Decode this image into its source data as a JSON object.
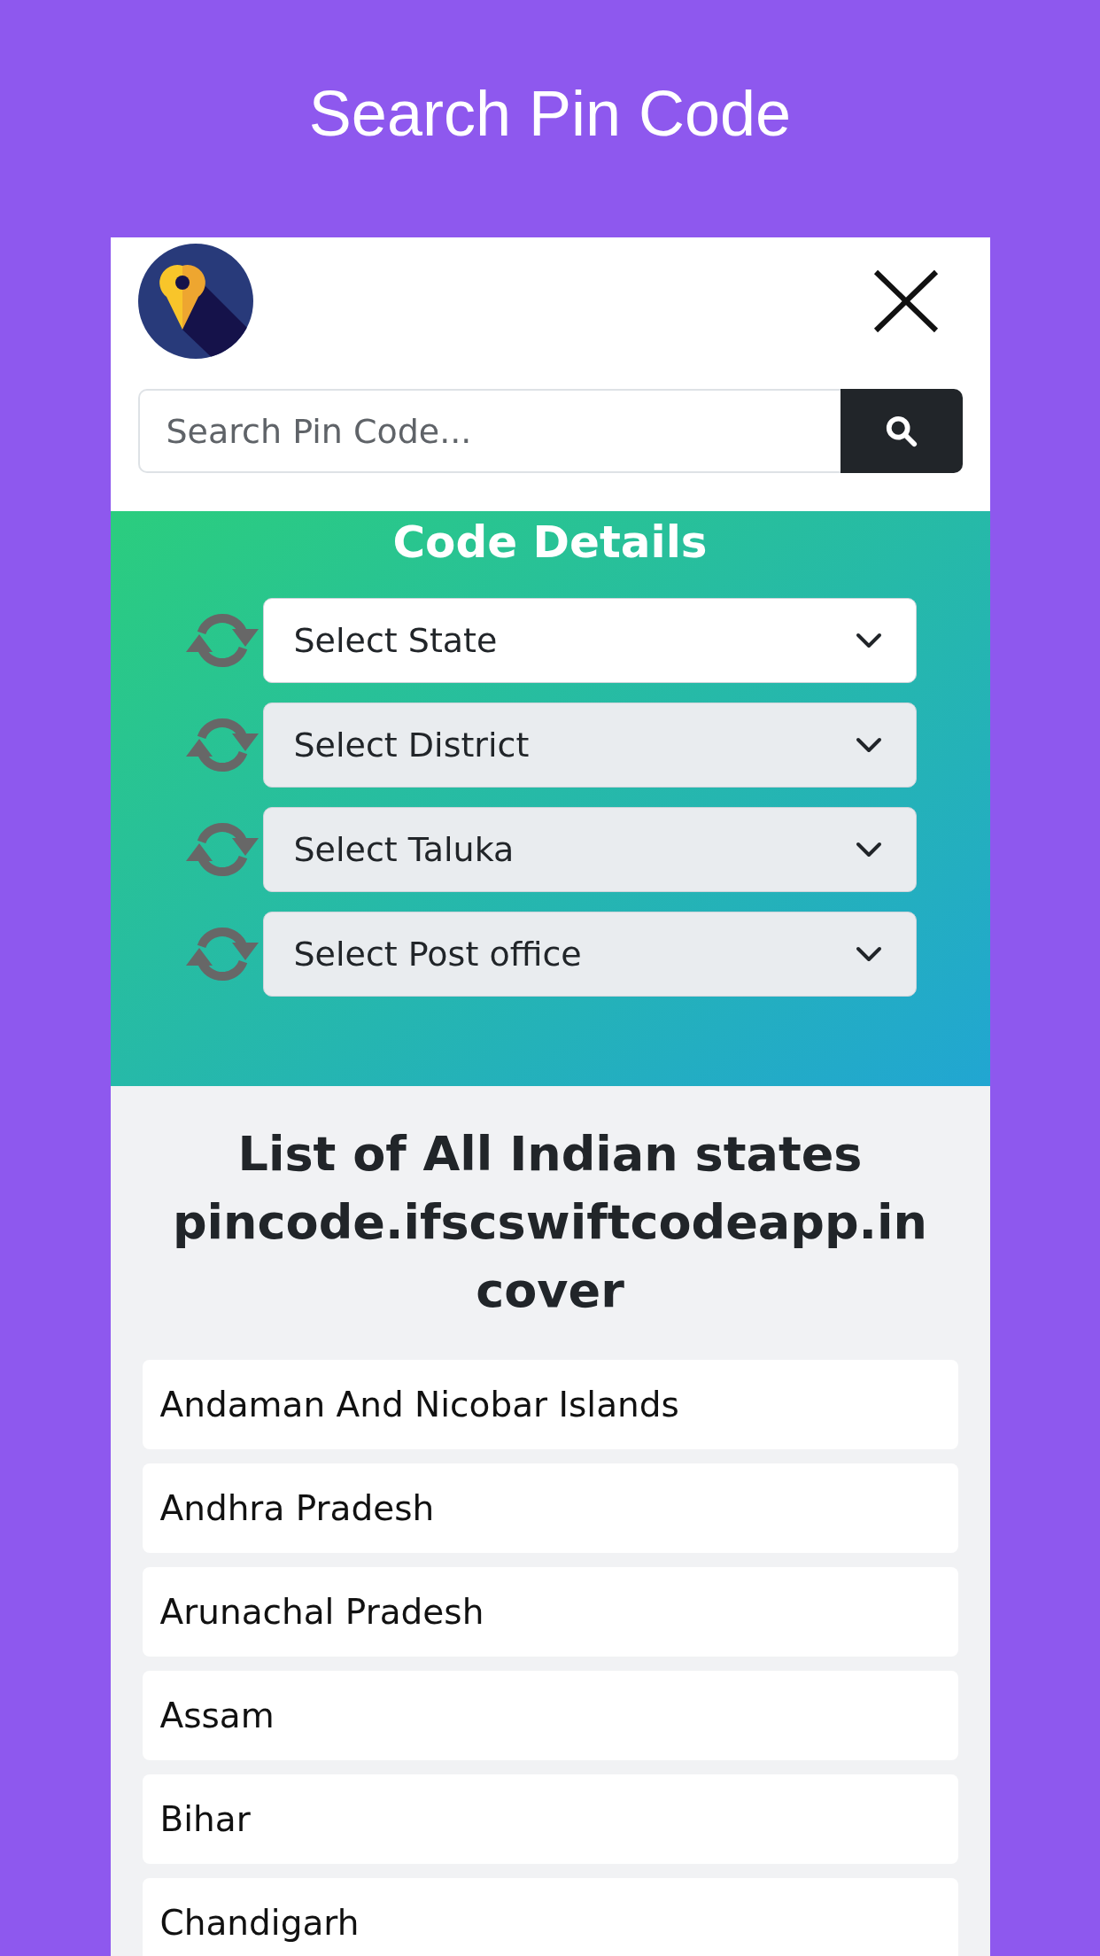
{
  "title": "Search Pin Code",
  "header": {
    "search": {
      "placeholder": "Search Pin Code..."
    }
  },
  "code_details": {
    "title": "Code Details",
    "selects": [
      {
        "value": "Select State",
        "disabled": false
      },
      {
        "value": "Select District",
        "disabled": true
      },
      {
        "value": "Select Taluka",
        "disabled": true
      },
      {
        "value": "Select Post office",
        "disabled": true
      }
    ]
  },
  "states_list": {
    "heading": "List of All Indian states pincode.ifscswiftcodeapp.in cover",
    "items": [
      "Andaman And Nicobar Islands",
      "Andhra Pradesh",
      "Arunachal Pradesh",
      "Assam",
      "Bihar",
      "Chandigarh"
    ]
  }
}
